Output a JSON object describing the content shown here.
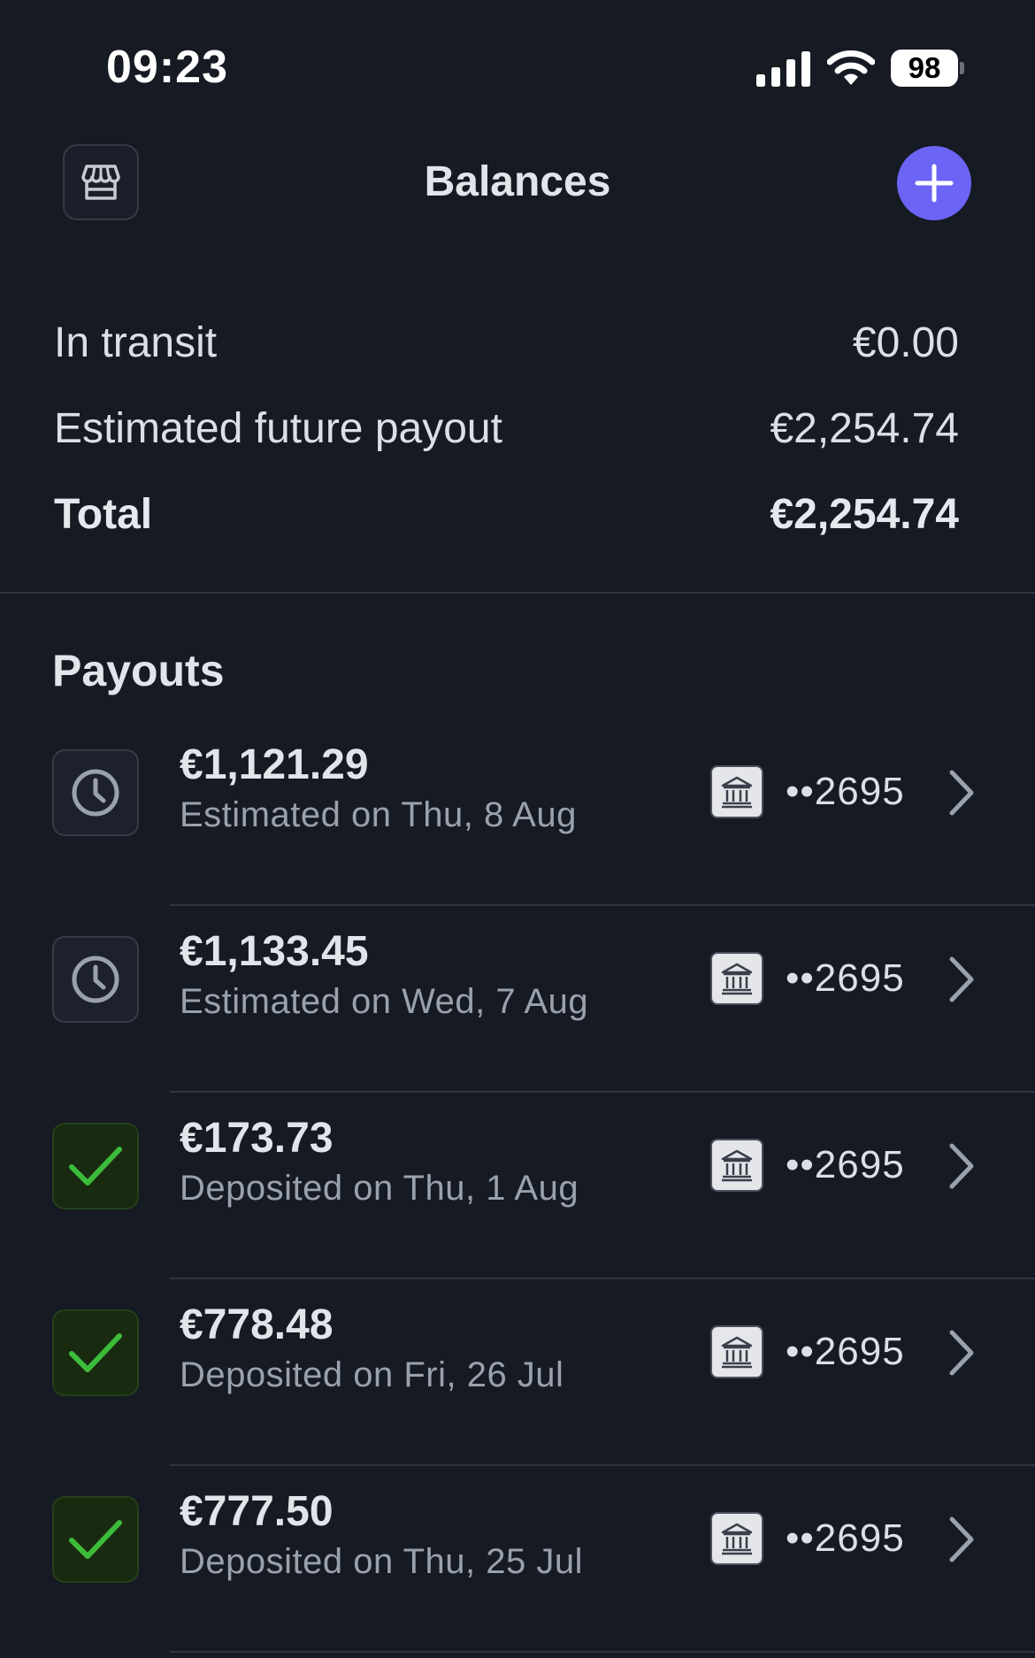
{
  "status_bar": {
    "time": "09:23",
    "battery_level": "98",
    "icons": [
      "signal-icon",
      "wifi-icon",
      "battery-icon"
    ]
  },
  "header": {
    "title": "Balances",
    "left_icon": "store-icon",
    "right_icon": "plus-icon"
  },
  "summary": {
    "in_transit_label": "In transit",
    "in_transit_value": "€0.00",
    "future_payout_label": "Estimated future payout",
    "future_payout_value": "€2,254.74",
    "total_label": "Total",
    "total_value": "€2,254.74"
  },
  "payouts": {
    "title": "Payouts",
    "items": [
      {
        "amount": "€1,121.29",
        "date": "Estimated on Thu, 8 Aug",
        "status": "pending",
        "status_icon": "clock-icon",
        "bank_icon": "bank-icon",
        "account": "••2695"
      },
      {
        "amount": "€1,133.45",
        "date": "Estimated on Wed, 7 Aug",
        "status": "pending",
        "status_icon": "clock-icon",
        "bank_icon": "bank-icon",
        "account": "••2695"
      },
      {
        "amount": "€173.73",
        "date": "Deposited on Thu, 1 Aug",
        "status": "deposited",
        "status_icon": "checkmark-icon",
        "bank_icon": "bank-icon",
        "account": "••2695"
      },
      {
        "amount": "€778.48",
        "date": "Deposited on Fri, 26 Jul",
        "status": "deposited",
        "status_icon": "checkmark-icon",
        "bank_icon": "bank-icon",
        "account": "••2695"
      },
      {
        "amount": "€777.50",
        "date": "Deposited on Thu, 25 Jul",
        "status": "deposited",
        "status_icon": "checkmark-icon",
        "bank_icon": "bank-icon",
        "account": "••2695"
      }
    ]
  },
  "colors": {
    "background": "#161a23",
    "accent": "#6b64f5",
    "success": "#3dbb3a",
    "muted_text": "#9aa1ae",
    "divider": "#2e3440"
  }
}
